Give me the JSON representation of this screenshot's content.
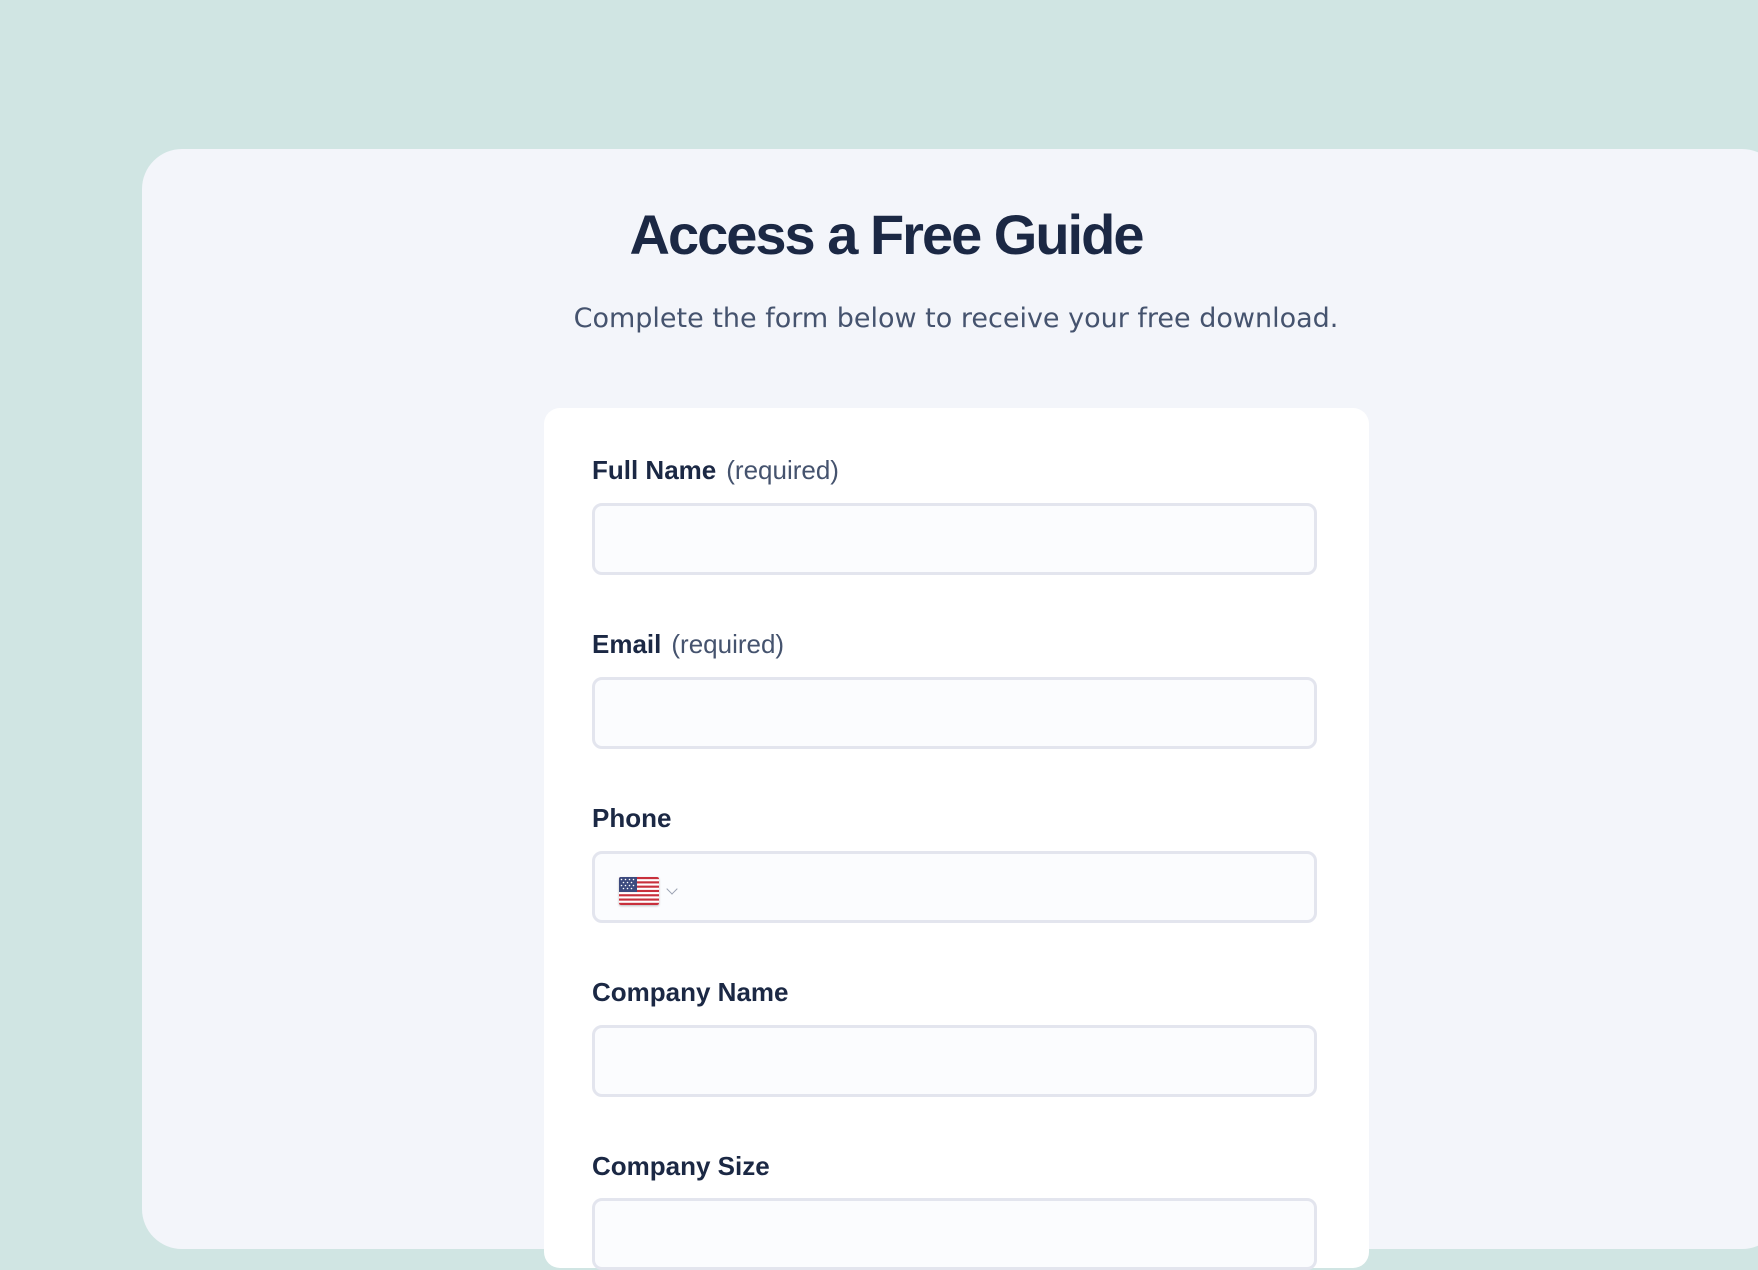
{
  "header": {
    "title": "Access a Free Guide",
    "subtitle": "Complete the form below to receive your free download."
  },
  "form": {
    "full_name": {
      "label": "Full Name",
      "required": "(required)",
      "value": "",
      "placeholder": ""
    },
    "email": {
      "label": "Email",
      "required": "(required)",
      "value": "",
      "placeholder": ""
    },
    "phone": {
      "label": "Phone",
      "country_icon": "us-flag-icon",
      "value": "",
      "placeholder": ""
    },
    "company_name": {
      "label": "Company Name",
      "value": "",
      "placeholder": ""
    },
    "company_size": {
      "label": "Company Size"
    }
  },
  "colors": {
    "page_background": "#d0e5e3",
    "panel_background": "#f3f5fa",
    "card_background": "#ffffff",
    "heading_text": "#1b2844",
    "muted_text": "#45536e",
    "input_border": "#e3e5ee"
  }
}
